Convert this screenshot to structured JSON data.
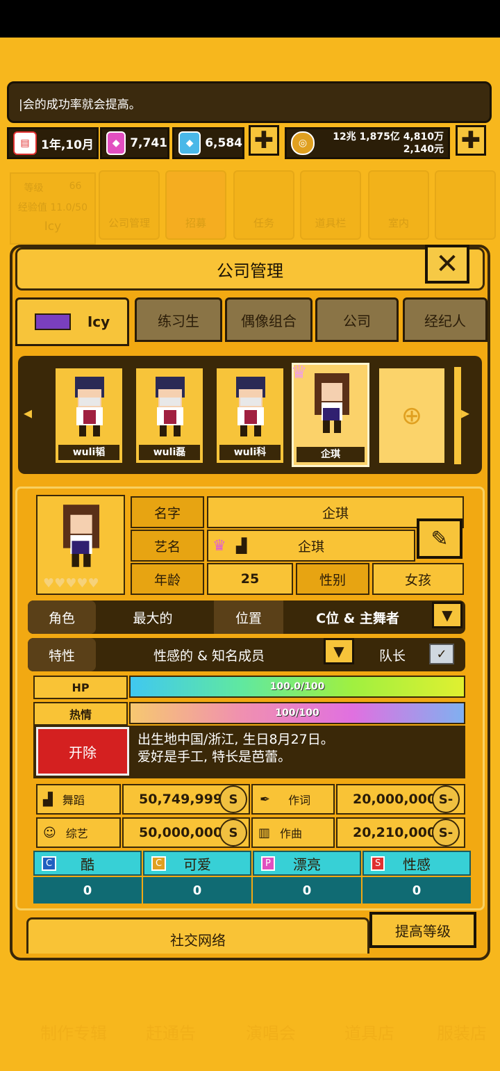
{
  "ticker": "|会的成功率就会提高。",
  "resources": {
    "date": "1年,10月",
    "pink_gem": "7,741",
    "blue_gem": "6,584",
    "money_line1": "12兆 1,875亿 4,810万",
    "money_line2": "2,140元"
  },
  "bg_nav": {
    "level_label": "等级",
    "level_value": "66",
    "exp_label": "经验值 11.0/50",
    "player": "Icy",
    "items": [
      "公司管理",
      "招募",
      "任务",
      "道具栏",
      "室内",
      ""
    ]
  },
  "panel": {
    "title": "公司管理",
    "tabs": [
      "Icy",
      "练习生",
      "偶像组合",
      "公司",
      "经纪人"
    ]
  },
  "members": [
    "wuli韬",
    "wuli磊",
    "wuli科",
    "企琪"
  ],
  "profile": {
    "name_label": "名字",
    "name_value": "企琪",
    "stage_label": "艺名",
    "stage_value": "企琪",
    "age_label": "年龄",
    "age_value": "25",
    "gender_label": "性别",
    "gender_value": "女孩",
    "role_label": "角色",
    "role_value": "最大的",
    "pos_label": "位置",
    "pos_value": "C位 & 主舞者",
    "trait_label": "特性",
    "trait_value": "性感的 & 知名成员",
    "leader_label": "队长"
  },
  "stats": {
    "hp_label": "HP",
    "hp_text": "100.0/100",
    "hp_fraction": 1.0,
    "passion_label": "热情",
    "passion_text": "100/100",
    "passion_fraction": 1.0
  },
  "fire_button": "开除",
  "bio_line1": "出生地中国/浙江, 生日8月27日。",
  "bio_line2": "爱好是手工, 特长是芭蕾。",
  "skills": [
    {
      "label": "舞蹈",
      "value": "50,749,999",
      "grade": "S"
    },
    {
      "label": "作词",
      "value": "20,000,000",
      "grade": "S-"
    },
    {
      "label": "综艺",
      "value": "50,000,000",
      "grade": "S"
    },
    {
      "label": "作曲",
      "value": "20,210,000",
      "grade": "S-"
    }
  ],
  "attrs": [
    {
      "label": "酷",
      "value": "0"
    },
    {
      "label": "可爱",
      "value": "0"
    },
    {
      "label": "漂亮",
      "value": "0"
    },
    {
      "label": "性感",
      "value": "0"
    }
  ],
  "buttons": {
    "social": "社交网络",
    "upgrade": "提高等级"
  },
  "bottom_nav": [
    "制作专辑",
    "赶通告",
    "演唱会",
    "道具店",
    "服装店"
  ]
}
